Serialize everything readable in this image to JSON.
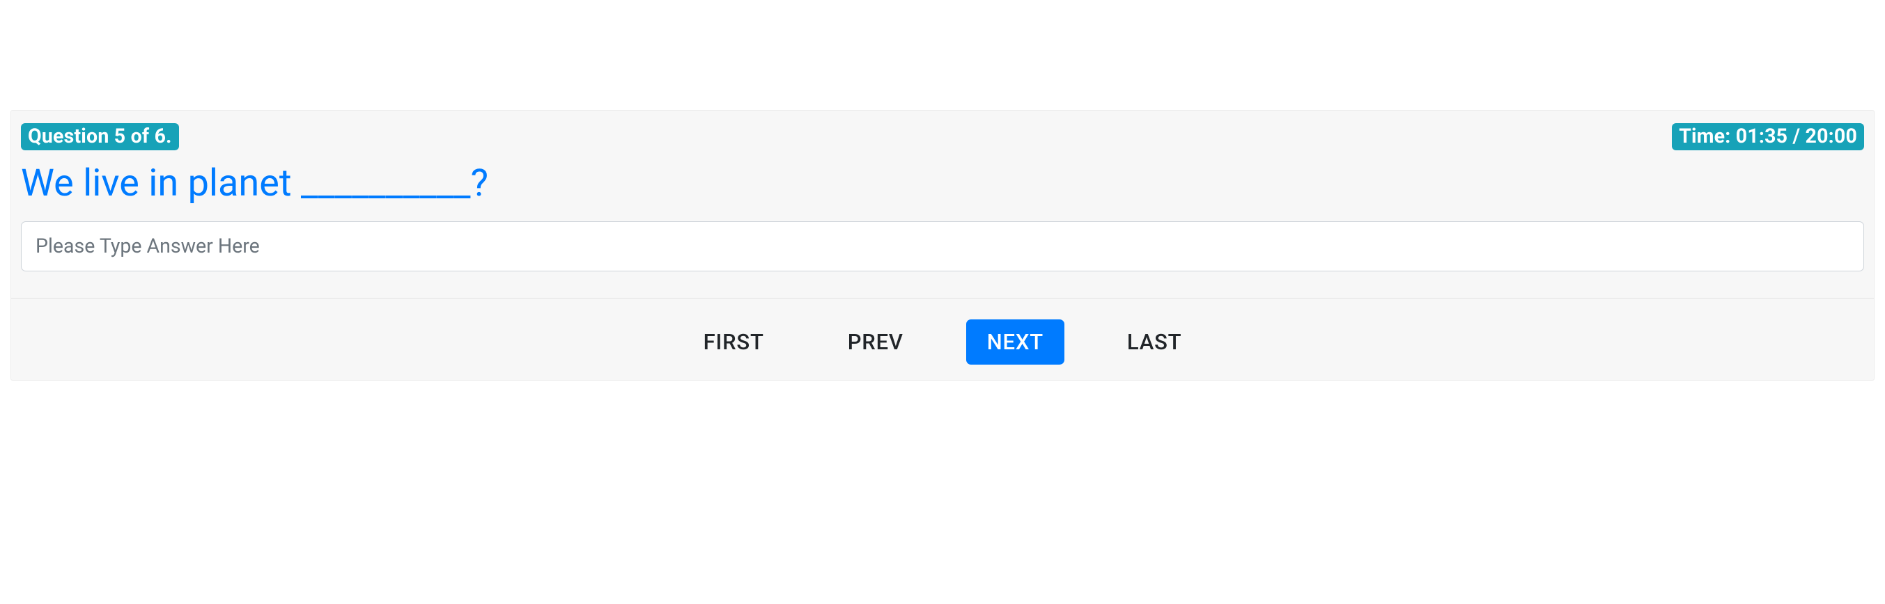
{
  "header": {
    "question_badge": "Question 5 of 6.",
    "time_badge": "Time: 01:35 / 20:00"
  },
  "main": {
    "question_text": "We live in planet __________?",
    "answer_value": "",
    "answer_placeholder": "Please Type Answer Here"
  },
  "nav": {
    "first": "FIRST",
    "prev": "PREV",
    "next": "NEXT",
    "last": "LAST"
  }
}
